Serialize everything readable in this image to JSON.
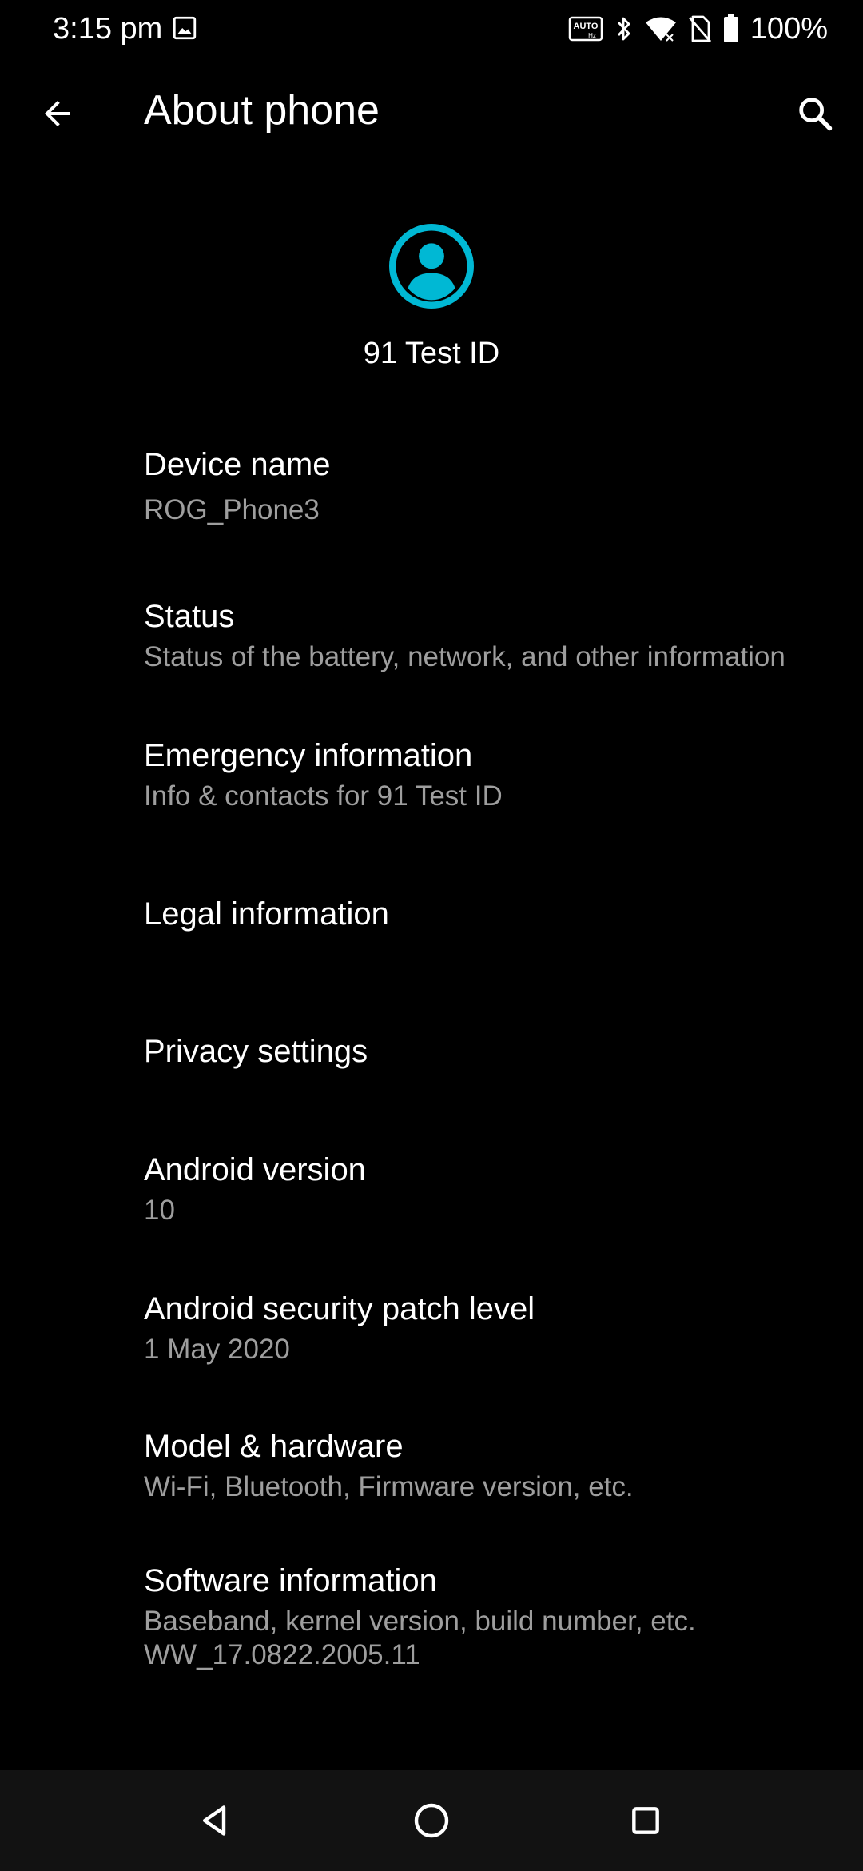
{
  "status_bar": {
    "time": "3:15 pm",
    "battery_percent": "100%",
    "auto_label": "AUTO",
    "hz_label": "Hz",
    "icons": [
      "gallery-icon",
      "auto-hz-icon",
      "bluetooth-icon",
      "wifi-icon",
      "no-sim-icon",
      "battery-icon"
    ]
  },
  "app_bar": {
    "title": "About phone",
    "back_icon": "arrow-back-icon",
    "search_icon": "search-icon"
  },
  "profile": {
    "name": "91 Test ID",
    "avatar_color": "#00B8D4",
    "avatar_icon": "account-circle-icon"
  },
  "items": [
    {
      "title": "Device name",
      "subtitle": "ROG_Phone3"
    },
    {
      "title": "Status",
      "subtitle": "Status of the battery, network, and other information"
    },
    {
      "title": "Emergency information",
      "subtitle": "Info & contacts for 91 Test ID"
    },
    {
      "title": "Legal information"
    },
    {
      "title": "Privacy settings"
    },
    {
      "title": "Android version",
      "subtitle": "10"
    },
    {
      "title": "Android security patch level",
      "subtitle": "1 May 2020"
    },
    {
      "title": "Model & hardware",
      "subtitle": "Wi-Fi, Bluetooth, Firmware version, etc."
    },
    {
      "title": "Software information",
      "subtitle": "Baseband, kernel version, build number, etc.",
      "subtitle2": "WW_17.0822.2005.11"
    }
  ],
  "nav_bar": {
    "icons": [
      "back-triangle-icon",
      "home-circle-icon",
      "recents-square-icon"
    ]
  },
  "colors": {
    "background": "#000000",
    "primary_text": "#FFFFFF",
    "secondary_text": "#9E9E9E",
    "accent": "#00B8D4",
    "nav_bar": "#121212"
  }
}
